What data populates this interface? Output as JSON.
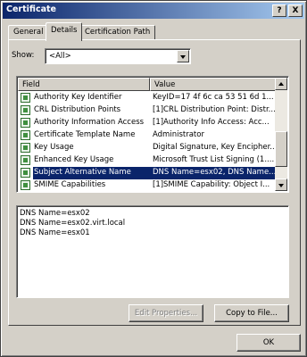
{
  "window": {
    "title": "Certificate",
    "help_label": "?",
    "close_label": "X"
  },
  "tabs": [
    {
      "label": "General"
    },
    {
      "label": "Details"
    },
    {
      "label": "Certification Path"
    }
  ],
  "show": {
    "label": "Show:",
    "value": "<All>"
  },
  "list": {
    "columns": [
      "Field",
      "Value"
    ],
    "rows": [
      {
        "field": "Authority Key Identifier",
        "value": "KeyID=17 4f 6c ca 53 51 6d 1..."
      },
      {
        "field": "CRL Distribution Points",
        "value": "[1]CRL Distribution Point: Distr..."
      },
      {
        "field": "Authority Information Access",
        "value": "[1]Authority Info Access: Acc..."
      },
      {
        "field": "Certificate Template Name",
        "value": "Administrator"
      },
      {
        "field": "Key Usage",
        "value": "Digital Signature, Key Encipher..."
      },
      {
        "field": "Enhanced Key Usage",
        "value": "Microsoft Trust List Signing (1...."
      },
      {
        "field": "Subject Alternative Name",
        "value": "DNS Name=esx02, DNS Name...",
        "selected": true
      },
      {
        "field": "SMIME Capabilities",
        "value": "[1]SMIME Capability: Object I..."
      }
    ]
  },
  "detail": {
    "lines": [
      "DNS Name=esx02",
      "DNS Name=esx02.virt.local",
      "DNS Name=esx01"
    ]
  },
  "buttons": {
    "edit_properties": "Edit Properties...",
    "copy_to_file": "Copy to File...",
    "ok": "OK"
  },
  "icons": {
    "row_icon": "certificate-field-icon",
    "dropdown": "chevron-down-icon"
  }
}
